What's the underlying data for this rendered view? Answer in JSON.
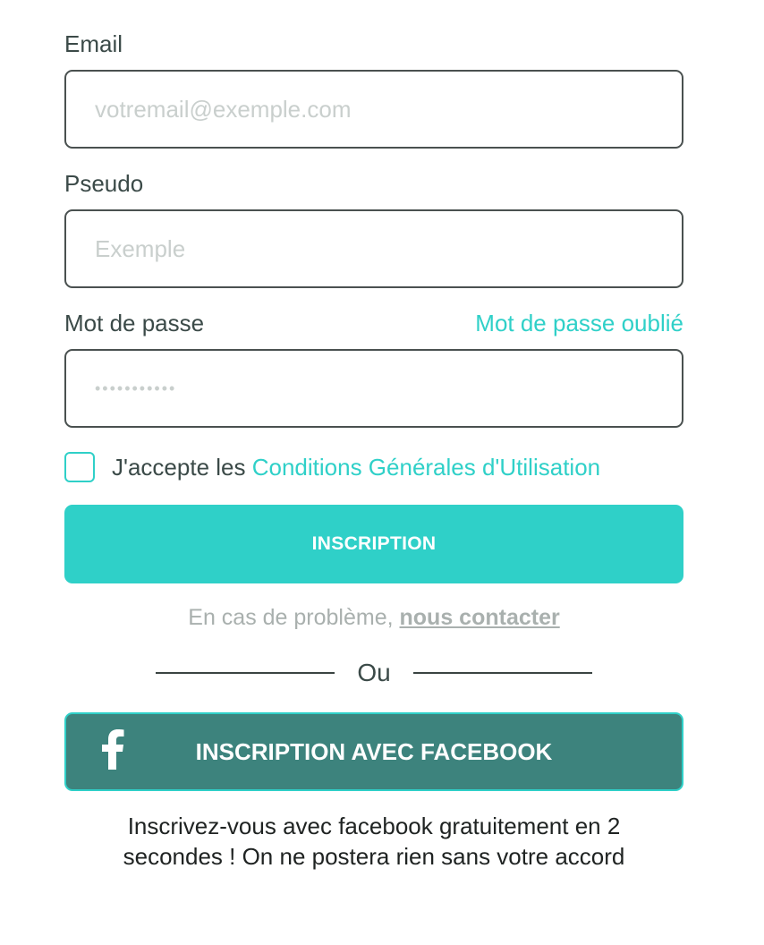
{
  "form": {
    "email": {
      "label": "Email",
      "placeholder": "votremail@exemple.com",
      "value": ""
    },
    "pseudo": {
      "label": "Pseudo",
      "placeholder": "Exemple",
      "value": ""
    },
    "password": {
      "label": "Mot de passe",
      "forgot_link": "Mot de passe oublié",
      "placeholder": "•••••••••••",
      "value": ""
    },
    "terms": {
      "checked": false,
      "prefix": "J'accepte les ",
      "link": "Conditions Générales d'Utilisation"
    },
    "submit_label": "INSCRIPTION",
    "help": {
      "prefix": "En cas de problème, ",
      "link": "nous contacter"
    },
    "divider_text": "Ou",
    "facebook": {
      "icon": "facebook-f-icon",
      "label": "INSCRIPTION AVEC FACEBOOK",
      "note_line1": "Inscrivez-vous avec facebook gratuitement en 2",
      "note_line2": "secondes ! On ne postera rien sans votre accord"
    }
  },
  "colors": {
    "accent": "#2fd0c8",
    "facebook_button": "#3d837d",
    "text": "#3b4a48",
    "muted": "#a9b0ae",
    "input_border": "#4a5150"
  }
}
